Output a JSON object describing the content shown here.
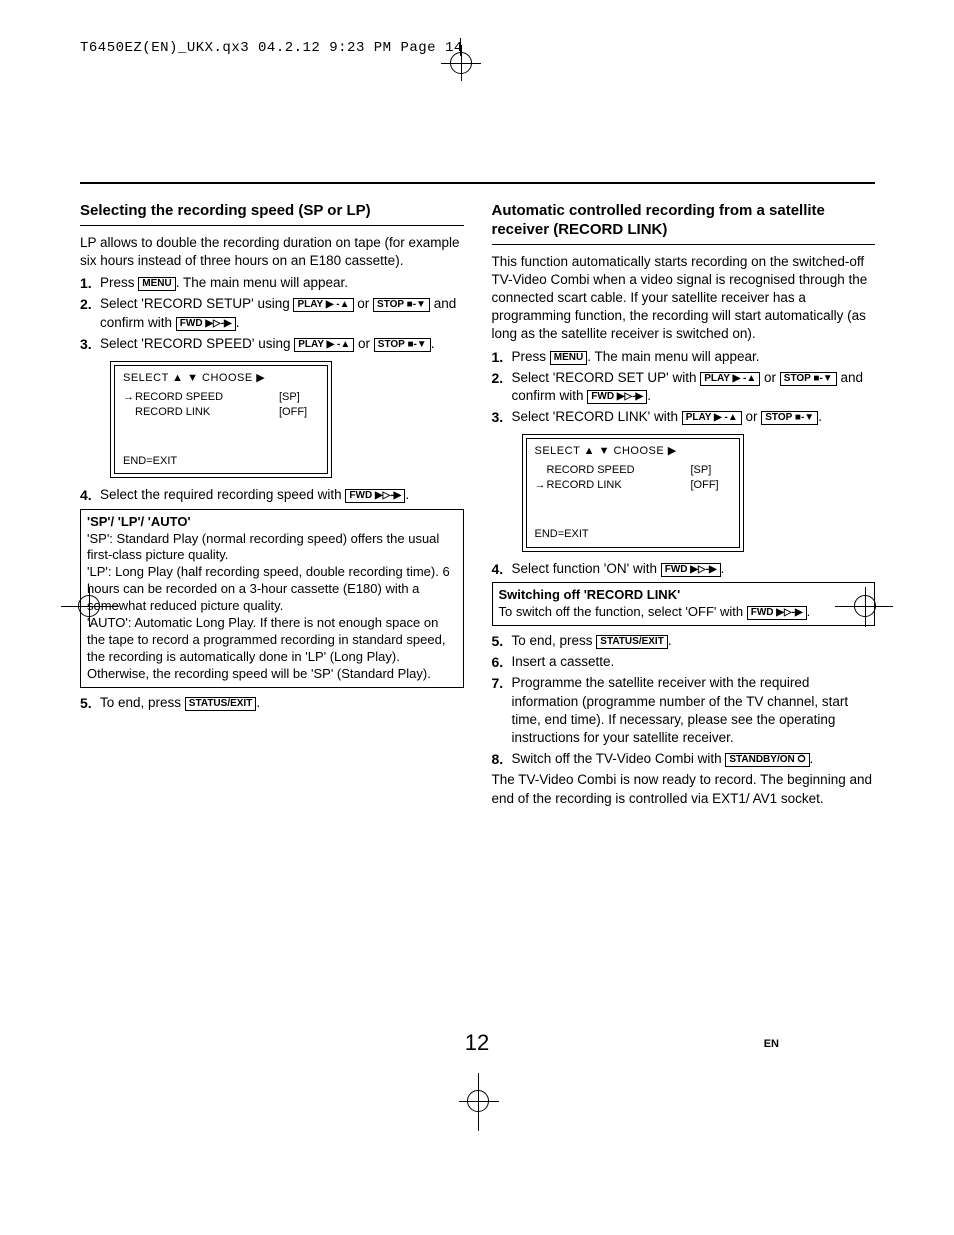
{
  "header_line": "T6450EZ(EN)_UKX.qx3  04.2.12  9:23 PM  Page 14",
  "page_number": "12",
  "lang_code": "EN",
  "buttons": {
    "menu": "MENU",
    "play": "PLAY ▶ -▲",
    "stop": "STOP ■-▼",
    "fwd": "FWD ▶▷-▶",
    "status_exit": "STATUS/EXIT",
    "standby": "STANDBY/ON ⭘"
  },
  "osd": {
    "title": "SELECT ▲ ▼ CHOOSE ▶",
    "rec_speed": "RECORD SPEED",
    "rec_link": "RECORD LINK",
    "sp": "[SP]",
    "off": "[OFF]",
    "end_exit": "END=EXIT",
    "arrow": "→"
  },
  "left": {
    "heading": "Selecting the recording speed (SP or LP)",
    "intro": "LP allows to double the recording duration on tape (for example six hours instead of three hours on an E180 cassette).",
    "s1a": "Press ",
    "s1b": ". The main menu will appear.",
    "s2a": "Select 'RECORD SETUP' using ",
    "s2_or": " or ",
    "s2b": " and confirm with ",
    "s2_dot": ".",
    "s3a": "Select 'RECORD SPEED' using ",
    "s3_or": " or ",
    "s3_dot": ".",
    "s4": "Select the required recording speed with ",
    "s4_dot": ".",
    "box_title": "'SP'/ 'LP'/ 'AUTO'",
    "box_sp": "'SP': Standard Play (normal recording speed) offers the usual first-class picture quality.",
    "box_lp": "'LP': Long Play (half recording speed, double recording time). 6 hours can be recorded on a 3-hour cassette (E180) with a somewhat reduced picture quality.",
    "box_auto": "'AUTO': Automatic Long Play. If there is not enough space on the tape to record a programmed recording in standard speed, the recording is automatically done in 'LP' (Long Play). Otherwise, the recording speed will be 'SP' (Standard Play).",
    "s5a": "To end, press ",
    "s5_dot": "."
  },
  "right": {
    "heading": "Automatic controlled recording from a satellite receiver (RECORD LINK)",
    "intro": "This function automatically starts recording on the switched-off TV-Video Combi when a video signal is recognised through the connected scart cable. If your satellite receiver has a programming function, the recording will start automatically (as long as the satellite receiver is switched on).",
    "s1a": "Press ",
    "s1b": ". The main menu will appear.",
    "s2a": "Select 'RECORD SET UP' with ",
    "s2_or": " or ",
    "s2b": " and confirm with ",
    "s2_dot": ".",
    "s3a": "Select 'RECORD LINK' with ",
    "s3_or": " or ",
    "s3_dot": ".",
    "s4a": "Select function 'ON' with ",
    "s4_dot": ".",
    "box_title": "Switching off 'RECORD LINK'",
    "box_body": "To switch off the function, select 'OFF' with ",
    "box_dot": ".",
    "s5a": "To end, press ",
    "s5_dot": ".",
    "s6": "Insert a cassette.",
    "s7": "Programme the satellite receiver with the required information (programme number of the TV channel, start time, end time). If necessary, please see the operating instructions for your satellite receiver.",
    "s8a": "Switch off the TV-Video Combi with ",
    "s8_dot": ".",
    "closing": "The TV-Video Combi is now ready to record. The beginning and end of the recording is controlled via EXT1/ AV1 socket."
  }
}
